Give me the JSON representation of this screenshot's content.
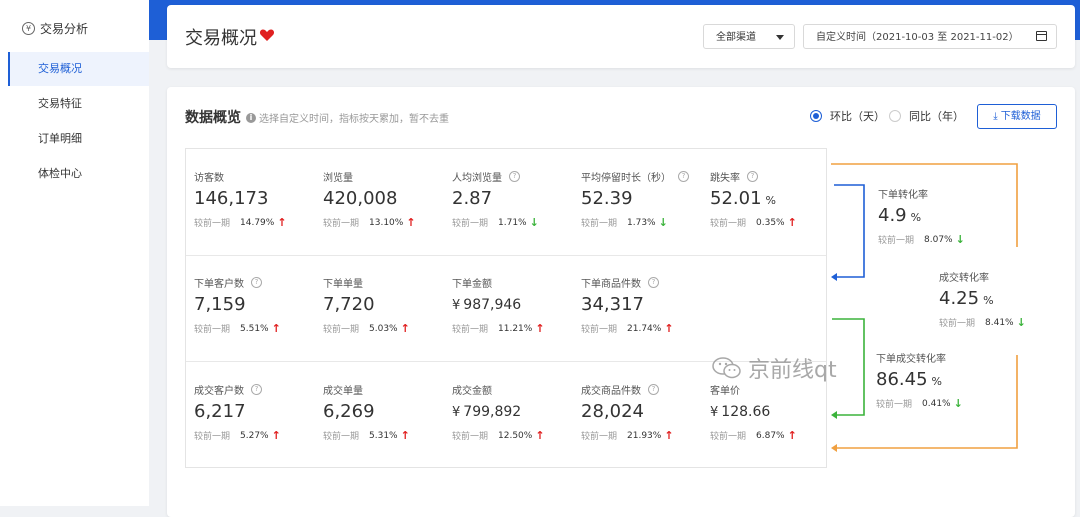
{
  "sidebar": {
    "header": "交易分析",
    "items": [
      {
        "label": "交易概况",
        "active": true
      },
      {
        "label": "交易特征",
        "active": false
      },
      {
        "label": "订单明细",
        "active": false
      },
      {
        "label": "体检中心",
        "active": false
      }
    ]
  },
  "header": {
    "title": "交易概况",
    "channel_select": "全部渠道",
    "date_range": "自定义时间（2021-10-03 至 2021-11-02）"
  },
  "overview": {
    "title": "数据概览",
    "hint": "选择自定义时间，指标按天累加，暂不去重",
    "radio_mom": "环比（天）",
    "radio_yoy": "同比（年）",
    "download_label": "下载数据",
    "compare_label": "较前一期"
  },
  "colors": {
    "accent": "#1e5fd6",
    "up": "#e02020",
    "down": "#3bb33b",
    "orange": "#f0a040",
    "green": "#3bb33b"
  },
  "metrics": [
    {
      "label": "访客数",
      "value": "146,173",
      "compare": "较前一期",
      "pct": "14.79%",
      "dir": "up",
      "help": false
    },
    {
      "label": "浏览量",
      "value": "420,008",
      "compare": "较前一期",
      "pct": "13.10%",
      "dir": "up",
      "help": false
    },
    {
      "label": "人均浏览量",
      "value": "2.87",
      "compare": "较前一期",
      "pct": "1.71%",
      "dir": "down",
      "help": true
    },
    {
      "label": "平均停留时长（秒）",
      "value": "52.39",
      "compare": "较前一期",
      "pct": "1.73%",
      "dir": "down",
      "help": true
    },
    {
      "label": "跳失率",
      "value": "52.01",
      "unit": "%",
      "compare": "较前一期",
      "pct": "0.35%",
      "dir": "up",
      "help": true
    },
    {
      "label": "下单客户数",
      "value": "7,159",
      "compare": "较前一期",
      "pct": "5.51%",
      "dir": "up",
      "help": true
    },
    {
      "label": "下单单量",
      "value": "7,720",
      "compare": "较前一期",
      "pct": "5.03%",
      "dir": "up",
      "help": false
    },
    {
      "label": "下单金额",
      "currency": "¥",
      "value": "987,946",
      "compare": "较前一期",
      "pct": "11.21%",
      "dir": "up",
      "help": false
    },
    {
      "label": "下单商品件数",
      "value": "34,317",
      "compare": "较前一期",
      "pct": "21.74%",
      "dir": "up",
      "help": true
    },
    {
      "label": "成交客户数",
      "value": "6,217",
      "compare": "较前一期",
      "pct": "5.27%",
      "dir": "up",
      "help": true
    },
    {
      "label": "成交单量",
      "value": "6,269",
      "compare": "较前一期",
      "pct": "5.31%",
      "dir": "up",
      "help": false
    },
    {
      "label": "成交金额",
      "currency": "¥",
      "value": "799,892",
      "compare": "较前一期",
      "pct": "12.50%",
      "dir": "up",
      "help": false
    },
    {
      "label": "成交商品件数",
      "value": "28,024",
      "compare": "较前一期",
      "pct": "21.93%",
      "dir": "up",
      "help": true
    },
    {
      "label": "客单价",
      "currency": "¥",
      "value": "128.66",
      "compare": "较前一期",
      "pct": "6.87%",
      "dir": "up",
      "help": false
    }
  ],
  "conversions": [
    {
      "label": "下单转化率",
      "value": "4.9",
      "unit": "%",
      "compare": "较前一期",
      "pct": "8.07%",
      "dir": "down"
    },
    {
      "label": "成交转化率",
      "value": "4.25",
      "unit": "%",
      "compare": "较前一期",
      "pct": "8.41%",
      "dir": "down"
    },
    {
      "label": "下单成交转化率",
      "value": "86.45",
      "unit": "%",
      "compare": "较前一期",
      "pct": "0.41%",
      "dir": "down"
    }
  ],
  "watermark": "京前线qt"
}
